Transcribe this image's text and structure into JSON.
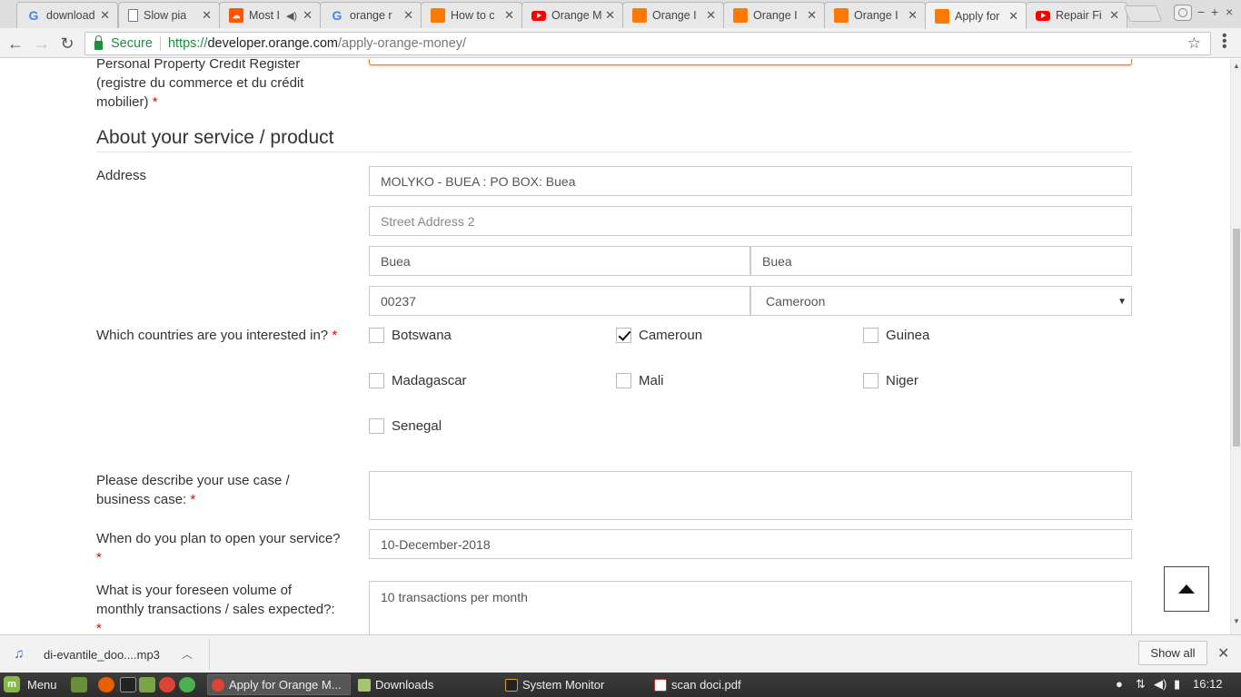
{
  "browser": {
    "tabs": [
      {
        "label": "download",
        "favicon": "google-icon"
      },
      {
        "label": "Slow pia",
        "favicon": "document-icon"
      },
      {
        "label": "Most I",
        "favicon": "soundcloud-icon",
        "audio": true
      },
      {
        "label": "orange r",
        "favicon": "google-icon"
      },
      {
        "label": "How to c",
        "favicon": "orange-icon"
      },
      {
        "label": "Orange M",
        "favicon": "youtube-icon"
      },
      {
        "label": "Orange I",
        "favicon": "orange-icon"
      },
      {
        "label": "Orange I",
        "favicon": "orange-icon"
      },
      {
        "label": "Orange I",
        "favicon": "orange-icon"
      },
      {
        "label": "Apply for",
        "favicon": "orange-icon",
        "active": true
      },
      {
        "label": "Repair Fi",
        "favicon": "youtube-icon"
      }
    ],
    "address": {
      "secure_label": "Secure",
      "scheme": "https://",
      "host": "developer.orange.com",
      "path": "/apply-orange-money/"
    },
    "window_controls": {
      "minimize": "−",
      "maximize": "+",
      "close": "×"
    }
  },
  "form": {
    "prev_label_lines": [
      "Personal Property Credit Register",
      "(registre du commerce et du crédit",
      "mobilier)"
    ],
    "required_mark": "*",
    "section_title": "About your service / product",
    "address": {
      "label": "Address",
      "street1": "MOLYKO - BUEA : PO BOX: Buea",
      "street2_placeholder": "Street Address 2",
      "city": "Buea",
      "state": "Buea",
      "postal": "00237",
      "country": "Cameroon"
    },
    "countries": {
      "label": "Which countries are you interested in?",
      "options": [
        {
          "name": "Botswana",
          "checked": false
        },
        {
          "name": "Cameroun",
          "checked": true
        },
        {
          "name": "Guinea",
          "checked": false
        },
        {
          "name": "Madagascar",
          "checked": false
        },
        {
          "name": "Mali",
          "checked": false
        },
        {
          "name": "Niger",
          "checked": false
        },
        {
          "name": "Senegal",
          "checked": false
        }
      ]
    },
    "use_case": {
      "label_lines": [
        "Please describe your use case /",
        "business case:"
      ],
      "value": ""
    },
    "open_date": {
      "label": "When do you plan to open your service?",
      "value": "10-December-2018"
    },
    "volume": {
      "label_lines": [
        "What is your foreseen volume of",
        "monthly transactions / sales expected?:"
      ],
      "value": "10 transactions per month"
    }
  },
  "downloads": {
    "file": "di-evantile_doo....mp3",
    "show_all": "Show all"
  },
  "taskbar": {
    "menu_label": "Menu",
    "tasks": [
      {
        "label": "Apply for Orange M...",
        "active": true
      },
      {
        "label": "Downloads",
        "active": false
      },
      {
        "label": "System Monitor",
        "active": false
      },
      {
        "label": "scan doci.pdf",
        "active": false
      }
    ],
    "clock": "16:12"
  },
  "colors": {
    "accent_orange": "#ff7900",
    "required_red": "#e00000",
    "secure_green": "#1e8e3e"
  }
}
